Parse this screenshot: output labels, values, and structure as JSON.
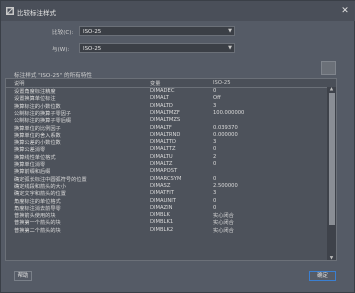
{
  "window": {
    "title": "比较标注样式",
    "close_glyph": "✕"
  },
  "compare": {
    "label": "比较(C):",
    "value": "ISO-25"
  },
  "with": {
    "label": "与(W):",
    "value": "ISO-25"
  },
  "section_title": "标注样式 \"ISO-25\" 的所有特性",
  "table": {
    "headers": [
      "说明",
      "变量",
      "ISO-25"
    ],
    "rows": [
      [
        "设置角度标注精度",
        "DIMADEC",
        "0"
      ],
      [
        "设置换算单位标注",
        "DIMALT",
        "Off"
      ],
      [
        "换算标注的小数位数",
        "DIMALTD",
        "3"
      ],
      [
        "公制标注的换算子零因子",
        "DIMALTMZF",
        "100.000000"
      ],
      [
        "公制标注的换算子零后缀",
        "DIMALTMZS",
        ""
      ],
      [
        "换算单位的比例因子",
        "DIMALTF",
        "0.039370"
      ],
      [
        "换算单位的舍入系数",
        "DIMALTRND",
        "0.000000"
      ],
      [
        "换算公差的小数位数",
        "DIMALTTD",
        "3"
      ],
      [
        "换算公差消零",
        "DIMALTTZ",
        "0"
      ],
      [
        "换算线性单位格式",
        "DIMALTU",
        "2"
      ],
      [
        "换算单位消零",
        "DIMALTZ",
        "0"
      ],
      [
        "换算前缀和后缀",
        "DIMAPOST",
        ""
      ],
      [
        "确定弧长标注中圆弧符号的位置",
        "DIMARCSYM",
        "0"
      ],
      [
        "确定线段和箭头的大小",
        "DIMASZ",
        "2.500000"
      ],
      [
        "确定文字和箭头的位置",
        "DIMATFIT",
        "3"
      ],
      [
        "角度标注的单位格式",
        "DIMAUNIT",
        "0"
      ],
      [
        "角度标注消去前导零",
        "DIMAZIN",
        "0"
      ],
      [
        "普换箭头使用的块",
        "DIMBLK",
        "实心闭合"
      ],
      [
        "普换第一个箭头的块",
        "DIMBLK1",
        "实心闭合"
      ],
      [
        "普换第二个箭头的块",
        "DIMBLK2",
        "实心闭合"
      ]
    ]
  },
  "buttons": {
    "help": "帮助",
    "ok": "确定"
  },
  "colors": {
    "background": "#555b66",
    "ok_border": "#3a7fd1"
  }
}
